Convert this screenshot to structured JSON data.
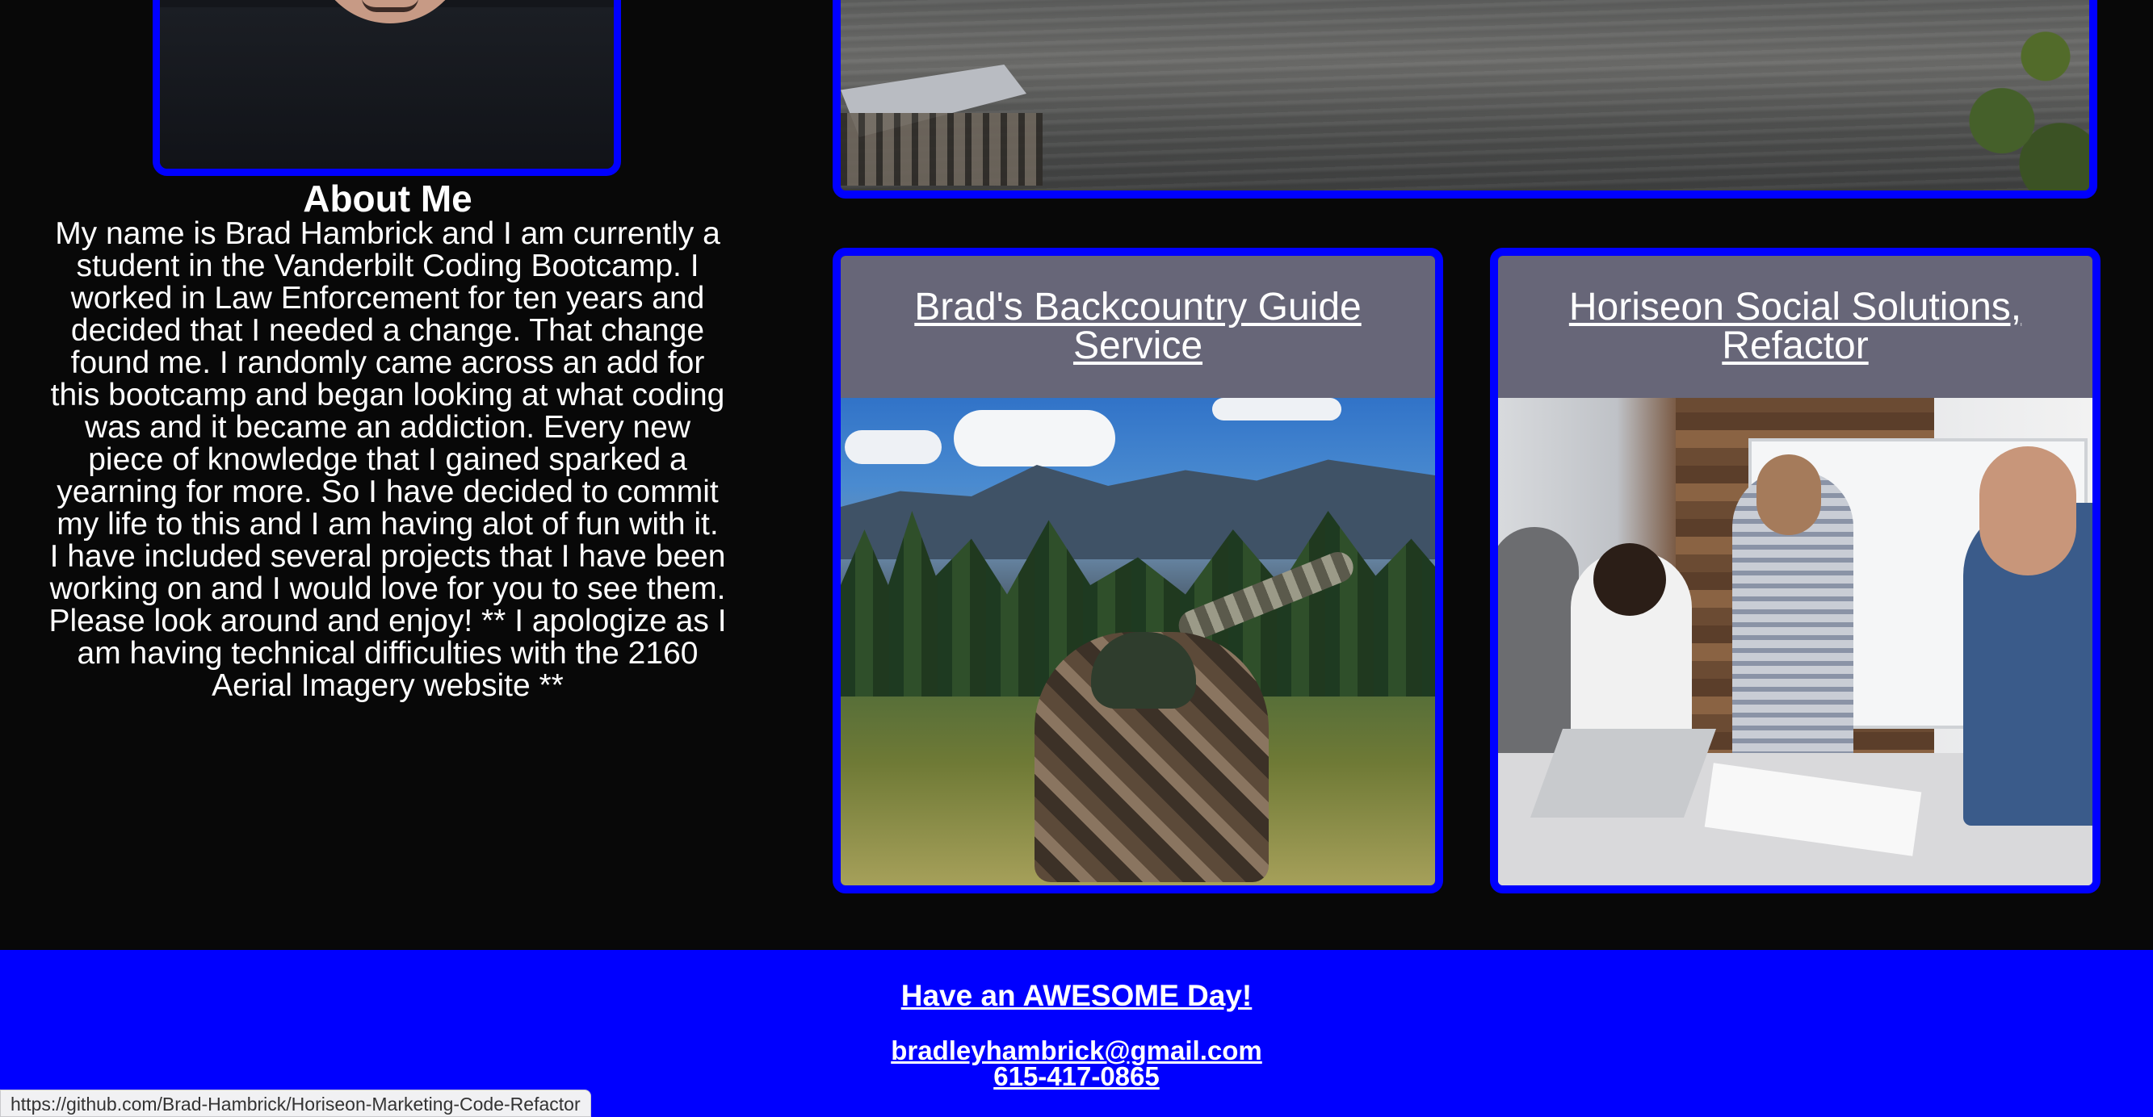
{
  "about": {
    "title": "About Me",
    "text": "My name is Brad Hambrick and I am currently a student in the Vanderbilt Coding Bootcamp. I worked in Law Enforcement for ten years and decided that I needed a change. That change found me. I randomly came across an add for this bootcamp and began looking at what coding was and it became an addiction. Every new piece of knowledge that I gained sparked a yearning for more. So I have decided to commit my life to this and I am having alot of fun with it. I have included several projects that I have been working on and I would love for you to see them. Please look around and enjoy! ** I apologize as I am having technical difficulties with the 2160 Aerial Imagery website **"
  },
  "projects": [
    {
      "title": "Brad's Backcountry Guide Service"
    },
    {
      "title": "Horiseon Social Solutions, Refactor"
    }
  ],
  "footer": {
    "tagline": "Have an AWESOME Day!",
    "email": "bradleyhambrick@gmail.com",
    "phone": "615-417-0865"
  },
  "status_bar": {
    "url": "https://github.com/Brad-Hambrick/Horiseon-Marketing-Code-Refactor"
  },
  "colors": {
    "accent": "#0000ff",
    "background": "#080808",
    "card_header": "#676678"
  }
}
